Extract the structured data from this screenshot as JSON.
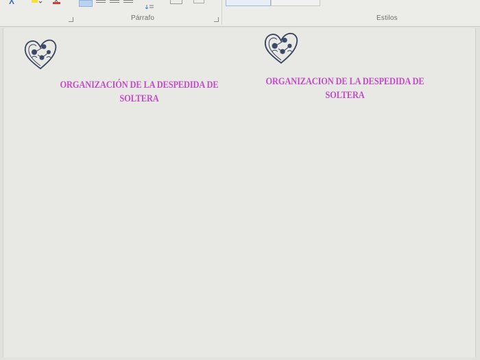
{
  "ribbon": {
    "group_paragraph": "Párrafo",
    "group_styles": "Estilos"
  },
  "document": {
    "title_left_line1": "ORGANIZACIÓN DE LA DESPEDIDA DE",
    "title_left_line2": "SOLTERA",
    "title_right_line1": "ORGANIZACION DE LA DESPEDIDA DE",
    "title_right_line2": "SOLTERA",
    "title_color": "#c54bc8",
    "decoration_icon": "floral-heart-icon"
  }
}
